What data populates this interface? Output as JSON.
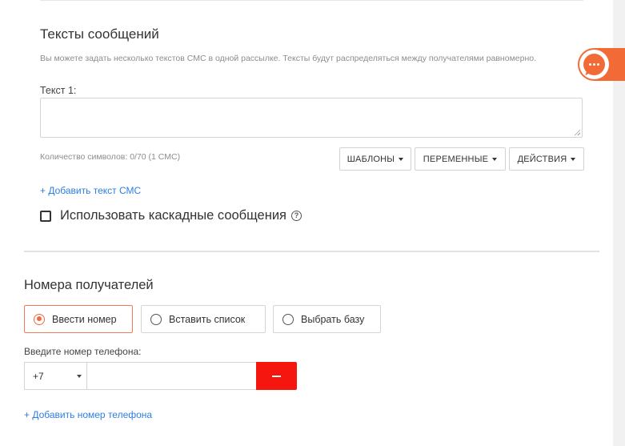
{
  "messages": {
    "title": "Тексты сообщений",
    "hint": "Вы можете задать несколько текстов СМС в одной рассылке. Тексты будут распределяться между получателями равномерно.",
    "text_label": "Текст 1:",
    "textarea_value": "",
    "char_count": "Количество символов: 0/70 (1 СМС)",
    "buttons": {
      "templates": "ШАБЛОНЫ",
      "variables": "ПЕРЕМЕННЫЕ",
      "actions": "ДЕЙСТВИЯ"
    },
    "add_sms_link": "+ Добавить текст СМС",
    "cascade_label": "Использовать каскадные сообщения",
    "cascade_checked": false,
    "help_glyph": "?"
  },
  "recipients": {
    "title": "Номера получателей",
    "options": [
      {
        "label": "Ввести номер",
        "selected": true
      },
      {
        "label": "Вставить список",
        "selected": false
      },
      {
        "label": "Выбрать базу",
        "selected": false
      }
    ],
    "phone_label": "Введите номер телефона:",
    "country_code": "+7",
    "phone_value": "",
    "add_phone_link": "+ Добавить номер телефона"
  },
  "chat_widget": {
    "icon": "chat-bubble-icon"
  },
  "colors": {
    "accent": "#f26b36",
    "link": "#2d7ee0",
    "danger": "#f5170f"
  }
}
